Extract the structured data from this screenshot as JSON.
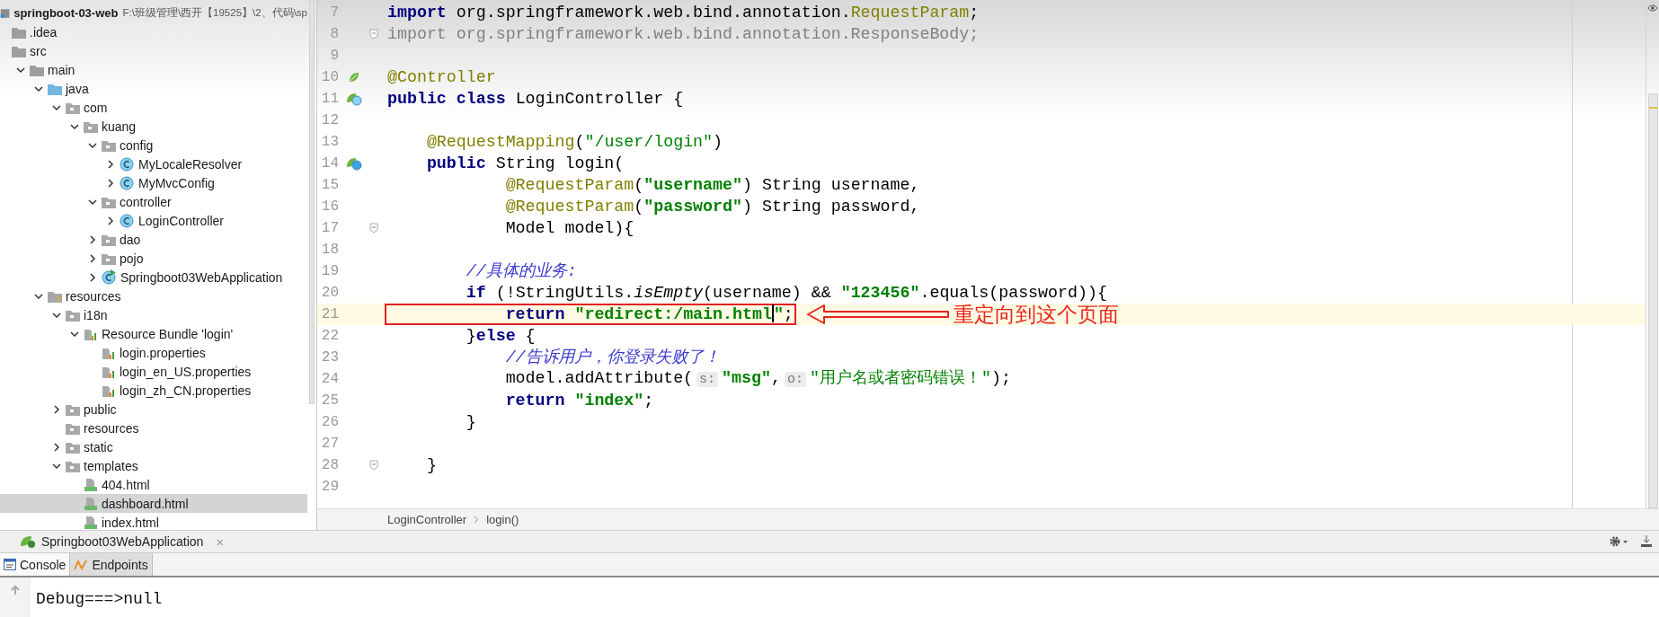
{
  "project": {
    "tree": [
      {
        "label": "springboot-03-web",
        "path": "F:\\班级管理\\西开【19525】\\2、代码\\sp",
        "kind": "module",
        "selected": false,
        "children": [
          {
            "label": ".idea",
            "kind": "folder",
            "selected": false
          },
          {
            "label": "src",
            "kind": "folder",
            "selected": false,
            "children": [
              {
                "label": "main",
                "kind": "folder",
                "expanded": true,
                "selected": false,
                "children": [
                  {
                    "label": "java",
                    "kind": "source",
                    "expanded": true,
                    "selected": false,
                    "children": [
                      {
                        "label": "com",
                        "kind": "package",
                        "expanded": true,
                        "selected": false,
                        "children": [
                          {
                            "label": "kuang",
                            "kind": "package",
                            "expanded": true,
                            "selected": false,
                            "children": [
                              {
                                "label": "config",
                                "kind": "package",
                                "expanded": true,
                                "selected": false,
                                "children": [
                                  {
                                    "label": "MyLocaleResolver",
                                    "kind": "class",
                                    "expanded": false,
                                    "selected": false
                                  },
                                  {
                                    "label": "MyMvcConfig",
                                    "kind": "class",
                                    "expanded": false,
                                    "selected": false
                                  }
                                ]
                              },
                              {
                                "label": "controller",
                                "kind": "package",
                                "expanded": true,
                                "selected": false,
                                "children": [
                                  {
                                    "label": "LoginController",
                                    "kind": "class",
                                    "expanded": false,
                                    "selected": false
                                  }
                                ]
                              },
                              {
                                "label": "dao",
                                "kind": "package",
                                "expanded": false,
                                "selected": false
                              },
                              {
                                "label": "pojo",
                                "kind": "package",
                                "expanded": false,
                                "selected": false
                              },
                              {
                                "label": "Springboot03WebApplication",
                                "kind": "app",
                                "expanded": false,
                                "selected": false
                              }
                            ]
                          }
                        ]
                      }
                    ]
                  },
                  {
                    "label": "resources",
                    "kind": "resources",
                    "expanded": true,
                    "selected": false,
                    "children": [
                      {
                        "label": "i18n",
                        "kind": "package",
                        "expanded": true,
                        "selected": false,
                        "children": [
                          {
                            "label": "Resource Bundle 'login'",
                            "kind": "bundle",
                            "expanded": true,
                            "selected": false,
                            "children": [
                              {
                                "label": "login.properties",
                                "kind": "properties",
                                "selected": false
                              },
                              {
                                "label": "login_en_US.properties",
                                "kind": "properties",
                                "selected": false
                              },
                              {
                                "label": "login_zh_CN.properties",
                                "kind": "properties",
                                "selected": false
                              }
                            ]
                          }
                        ]
                      },
                      {
                        "label": "public",
                        "kind": "package",
                        "expanded": false,
                        "selected": false
                      },
                      {
                        "label": "resources",
                        "kind": "package",
                        "selected": false
                      },
                      {
                        "label": "static",
                        "kind": "package",
                        "expanded": false,
                        "selected": false
                      },
                      {
                        "label": "templates",
                        "kind": "package",
                        "expanded": true,
                        "selected": false,
                        "children": [
                          {
                            "label": "404.html",
                            "kind": "html",
                            "selected": false
                          },
                          {
                            "label": "dashboard.html",
                            "kind": "html",
                            "selected": true
                          },
                          {
                            "label": "index.html",
                            "kind": "html",
                            "selected": false
                          }
                        ]
                      }
                    ]
                  }
                ]
              }
            ]
          }
        ]
      }
    ]
  },
  "editor": {
    "lines": [
      {
        "number": "7",
        "current": false,
        "tokens": [
          {
            "kind": "keyword",
            "text": "import"
          },
          {
            "kind": "plain",
            "text": " org.springframework.web.bind.annotation."
          },
          {
            "kind": "annotation",
            "text": "RequestParam"
          },
          {
            "kind": "plain",
            "text": ";"
          }
        ]
      },
      {
        "number": "8",
        "current": false,
        "gutter": {
          "kind": "fold"
        },
        "tokens": [
          {
            "kind": "unused",
            "text": "import org.springframework.web.bind.annotation.ResponseBody;"
          }
        ]
      },
      {
        "number": "9",
        "current": false
      },
      {
        "number": "10",
        "current": false,
        "gutter": {
          "kind": "spring"
        },
        "tokens": [
          {
            "kind": "annotation",
            "text": "@Controller"
          }
        ]
      },
      {
        "number": "11",
        "current": false,
        "gutter": {
          "kind": "spring-class"
        },
        "tokens": [
          {
            "kind": "keyword",
            "text": "public class"
          },
          {
            "kind": "plain",
            "text": " LoginController {"
          }
        ]
      },
      {
        "number": "12",
        "current": false
      },
      {
        "number": "13",
        "current": false,
        "tokens": [
          {
            "kind": "annotation",
            "text": "    @RequestMapping"
          },
          {
            "kind": "plain",
            "text": "("
          },
          {
            "kind": "string-plain",
            "text": "\"/user/login\""
          },
          {
            "kind": "plain",
            "text": ")"
          }
        ]
      },
      {
        "number": "14",
        "current": false,
        "gutter": {
          "kind": "spring-web"
        },
        "tokens": [
          {
            "kind": "keyword",
            "text": "    public"
          },
          {
            "kind": "plain",
            "text": " String login("
          }
        ]
      },
      {
        "number": "15",
        "current": false,
        "tokens": [
          {
            "kind": "annotation",
            "text": "            @RequestParam"
          },
          {
            "kind": "plain",
            "text": "("
          },
          {
            "kind": "string",
            "text": "\"username\""
          },
          {
            "kind": "plain",
            "text": ") String username,"
          }
        ]
      },
      {
        "number": "16",
        "current": false,
        "tokens": [
          {
            "kind": "annotation",
            "text": "            @RequestParam"
          },
          {
            "kind": "plain",
            "text": "("
          },
          {
            "kind": "string",
            "text": "\"password\""
          },
          {
            "kind": "plain",
            "text": ") String password,"
          }
        ]
      },
      {
        "number": "17",
        "current": false,
        "gutter": {
          "kind": "fold"
        },
        "tokens": [
          {
            "kind": "plain",
            "text": "            Model model){"
          }
        ]
      },
      {
        "number": "18",
        "current": false
      },
      {
        "number": "19",
        "current": false,
        "tokens": [
          {
            "kind": "comment",
            "text": "        //具体的业务:"
          }
        ]
      },
      {
        "number": "20",
        "current": false,
        "tokens": [
          {
            "kind": "keyword",
            "text": "        if"
          },
          {
            "kind": "plain",
            "text": " (!StringUtils."
          },
          {
            "kind": "static",
            "text": "isEmpty"
          },
          {
            "kind": "plain",
            "text": "(username) && "
          },
          {
            "kind": "string",
            "text": "\"123456\""
          },
          {
            "kind": "plain",
            "text": ".equals(password)){"
          }
        ]
      },
      {
        "number": "21",
        "current": true,
        "callout": "重定向到这个页面",
        "tokens": [
          {
            "kind": "keyword",
            "text": "            return",
            "boxed": true
          },
          {
            "kind": "string",
            "text": " \"redirect:/main.html",
            "boxed": true
          },
          {
            "kind": "caret",
            "boxed": true
          },
          {
            "kind": "string",
            "text": "\"",
            "boxed": true
          },
          {
            "kind": "plain",
            "text": ";",
            "boxed": true
          }
        ]
      },
      {
        "number": "22",
        "current": false,
        "tokens": [
          {
            "kind": "plain",
            "text": "        }"
          },
          {
            "kind": "keyword",
            "text": "else"
          },
          {
            "kind": "plain",
            "text": " {"
          }
        ]
      },
      {
        "number": "23",
        "current": false,
        "tokens": [
          {
            "kind": "comment",
            "text": "            //告诉用户，你登录失败了！"
          }
        ]
      },
      {
        "number": "24",
        "current": false,
        "tokens": [
          {
            "kind": "plain",
            "text": "            model.addAttribute("
          },
          {
            "kind": "hint",
            "text": "s:"
          },
          {
            "kind": "string",
            "text": "\"msg\""
          },
          {
            "kind": "plain",
            "text": ","
          },
          {
            "kind": "hint",
            "text": "o:"
          },
          {
            "kind": "string-plain",
            "text": "\"用户名或者密码错误！\""
          },
          {
            "kind": "plain",
            "text": ");"
          }
        ]
      },
      {
        "number": "25",
        "current": false,
        "tokens": [
          {
            "kind": "keyword",
            "text": "            return"
          },
          {
            "kind": "string",
            "text": " \"index\""
          },
          {
            "kind": "plain",
            "text": ";"
          }
        ]
      },
      {
        "number": "26",
        "current": false,
        "tokens": [
          {
            "kind": "plain",
            "text": "        }"
          }
        ]
      },
      {
        "number": "27",
        "current": false
      },
      {
        "number": "28",
        "current": false,
        "gutter": {
          "kind": "fold"
        },
        "tokens": [
          {
            "kind": "plain",
            "text": "    }"
          }
        ]
      },
      {
        "number": "29",
        "current": false
      }
    ],
    "breadcrumb": [
      "LoginController",
      "login()"
    ]
  },
  "run_panel": {
    "tab": {
      "label": "Springboot03WebApplication",
      "close": "×"
    },
    "console_tabs": [
      {
        "label": "Console",
        "kind": "console",
        "selected": true
      },
      {
        "label": "Endpoints",
        "kind": "endpoints",
        "selected": false
      }
    ],
    "output": [
      "Debug===>null"
    ]
  }
}
